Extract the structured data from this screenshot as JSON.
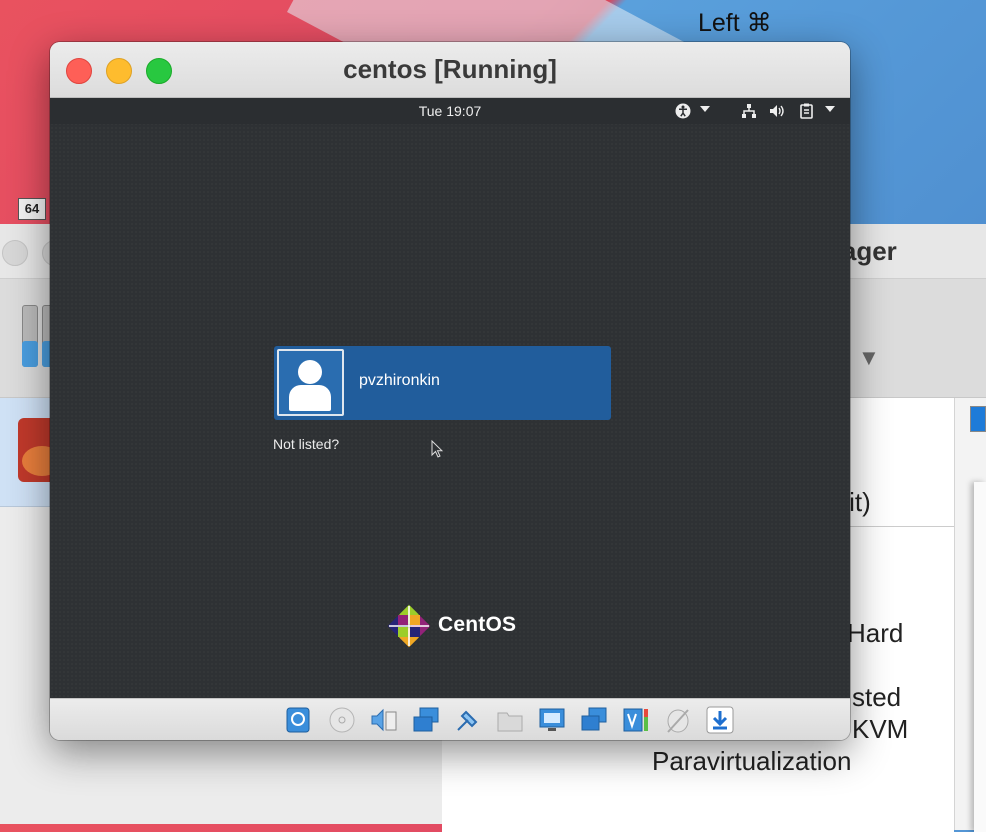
{
  "vm_window": {
    "title": "centos [Running]"
  },
  "guest": {
    "clock": "Tue 19:07",
    "user": {
      "name": "pvzhironkin"
    },
    "not_listed": "Not listed?",
    "brand": "CentOS"
  },
  "status_bar": {
    "host_key": "Left ⌘",
    "icons": [
      "hard-disk-icon",
      "optical-drive-icon",
      "audio-icon",
      "network-icon",
      "usb-icon",
      "shared-folders-icon",
      "display-icon",
      "video-capture-icon",
      "recording-cpu-icon",
      "mouse-integration-icon",
      "host-key-download-icon"
    ]
  },
  "manager": {
    "title_partial": "nager",
    "badge": "64",
    "details_partial": {
      "bits": "-bit)",
      "hard": "Hard",
      "nested": "sted",
      "kvm": "KVM",
      "paravirt": "Paravirtualization"
    }
  },
  "colors": {
    "selection_blue": "#215d9c",
    "desktop_dark": "#2e3134",
    "close": "#fe5f57",
    "minimize": "#febc2e",
    "zoom": "#28c840"
  }
}
